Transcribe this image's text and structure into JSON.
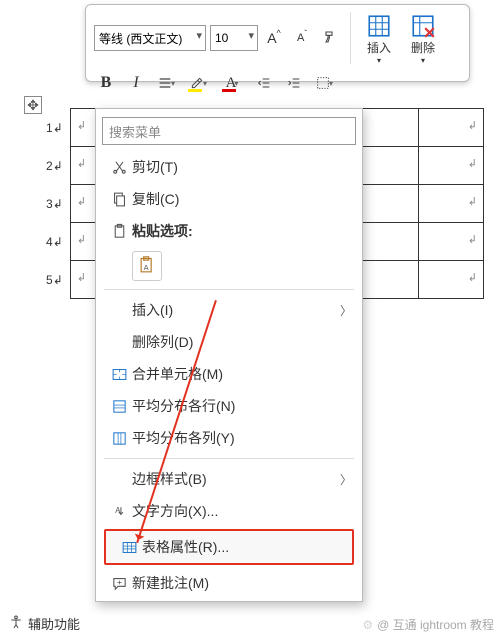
{
  "ribbon": {
    "font_name": "等线 (西文正文)",
    "font_size": "10",
    "grow_label": "A",
    "shrink_label": "A",
    "insert_label": "插入",
    "delete_label": "删除",
    "bold": "B",
    "italic": "I",
    "font_a": "A"
  },
  "rows": [
    "1",
    "2",
    "3",
    "4",
    "5"
  ],
  "menu": {
    "search_placeholder": "搜索菜单",
    "cut": "剪切(T)",
    "copy": "复制(C)",
    "paste_opts": "粘贴选项:",
    "insert": "插入(I)",
    "delete_col": "删除列(D)",
    "merge": "合并单元格(M)",
    "dist_rows": "平均分布各行(N)",
    "dist_cols": "平均分布各列(Y)",
    "border_style": "边框样式(B)",
    "text_dir": "文字方向(X)...",
    "table_props": "表格属性(R)...",
    "new_comment": "新建批注(M)"
  },
  "footer": {
    "label": "辅助功能"
  },
  "watermark": {
    "text": "@ 互通 ightroom 教程"
  }
}
